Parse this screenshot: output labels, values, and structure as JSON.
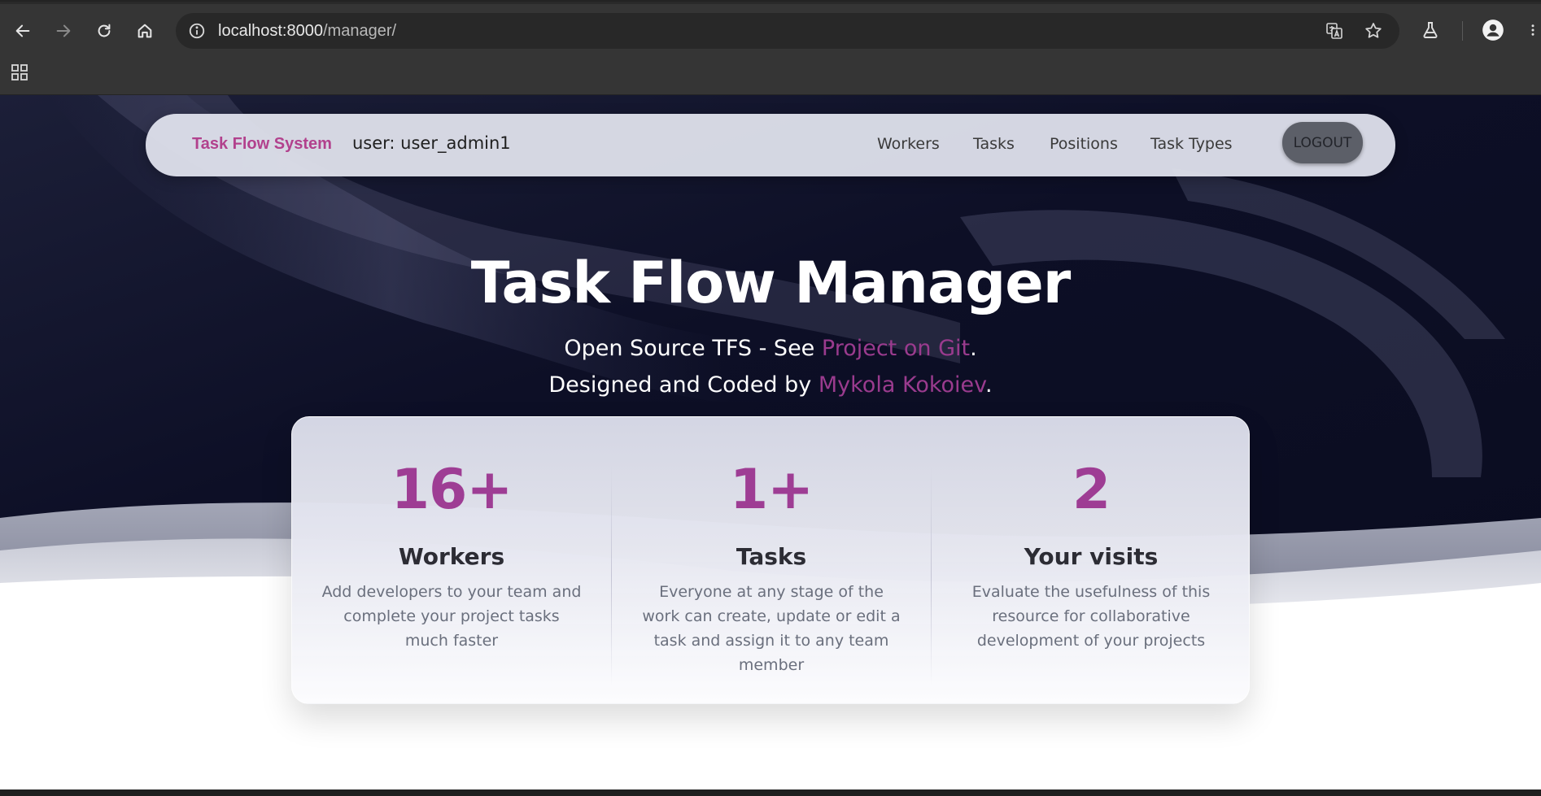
{
  "browser": {
    "url_host": "localhost:8000",
    "url_path": "/manager/",
    "icons": {
      "back": "arrow-left-icon",
      "forward": "arrow-right-icon",
      "reload": "reload-icon",
      "home": "home-icon",
      "info": "info-icon",
      "translate": "translate-icon",
      "bookmark": "star-icon",
      "labs": "flask-icon",
      "profile": "profile-icon",
      "menu": "more-vert-icon",
      "apps": "apps-grid-icon"
    }
  },
  "navbar": {
    "brand": "Task Flow System",
    "user_label": "user: user_admin1",
    "links": [
      "Workers",
      "Tasks",
      "Positions",
      "Task Types"
    ],
    "logout_label": "LOGOUT"
  },
  "hero": {
    "title": "Task Flow Manager",
    "line1_prefix": "Open Source TFS - See ",
    "line1_link": "Project on Git",
    "line1_suffix": ".",
    "line2_prefix": "Designed and Coded by ",
    "line2_link": "Mykola Kokoiev",
    "line2_suffix": "."
  },
  "stats": [
    {
      "value": "16+",
      "title": "Workers",
      "description": "Add developers to your team and complete your project tasks much faster"
    },
    {
      "value": "1+",
      "title": "Tasks",
      "description": "Everyone at any stage of the work can create, update or edit a task and assign it to any team member"
    },
    {
      "value": "2",
      "title": "Your visits",
      "description": "Evaluate the usefulness of this resource for collaborative development of your projects"
    }
  ],
  "colors": {
    "accent": "#9e3d94",
    "brand": "#b2418d",
    "hero_background": "#0d0f26",
    "browser_chrome": "#353535"
  }
}
